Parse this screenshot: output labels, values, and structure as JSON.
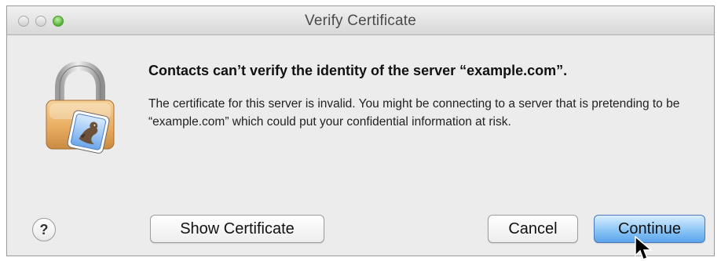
{
  "window": {
    "title": "Verify Certificate"
  },
  "icons": {
    "app": "lock-with-contacts-icon",
    "help": "help-icon",
    "cursor": "pointer-cursor-icon"
  },
  "message": {
    "heading": "Contacts can’t verify the identity of the server “example.com”.",
    "body": "The certificate for this server is invalid. You might be connecting to a server that is pretending to be “example.com” which could put your confidential information at risk."
  },
  "help": {
    "symbol": "?"
  },
  "buttons": {
    "show_certificate": "Show Certificate",
    "cancel": "Cancel",
    "continue": "Continue"
  },
  "colors": {
    "zoom_button": "#58b63a",
    "default_button": "#8cc6f5"
  }
}
